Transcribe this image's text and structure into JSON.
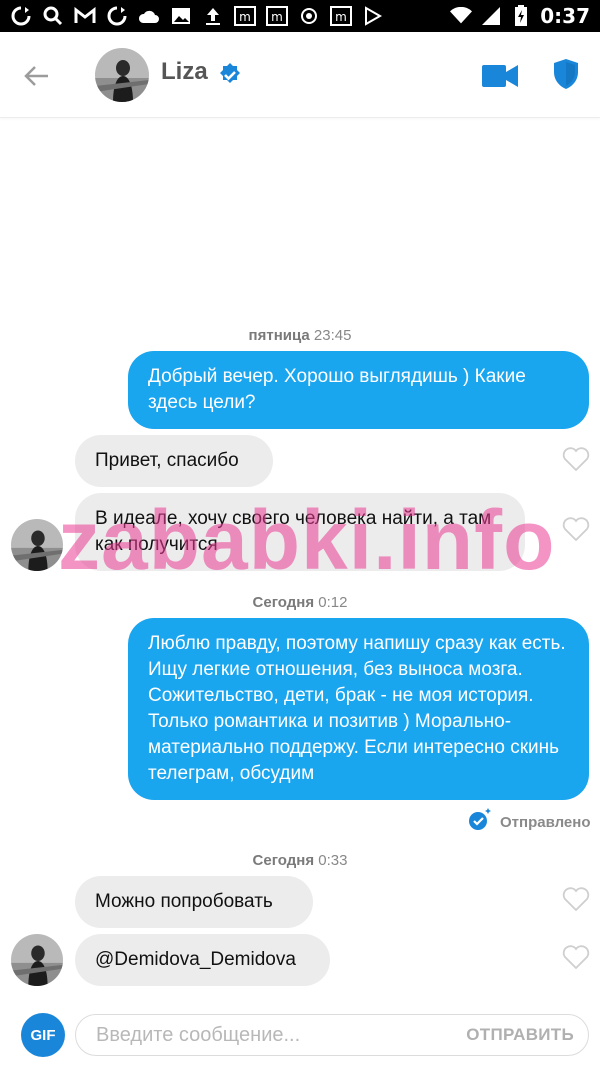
{
  "status_bar": {
    "time": "0:37",
    "icons": [
      "sync-icon",
      "search-icon",
      "gmail-icon",
      "sync-icon",
      "cloud-icon",
      "image-icon",
      "upload-icon",
      "m-icon",
      "m-icon",
      "android-icon",
      "m-icon",
      "play-icon",
      "wifi-icon",
      "signal-icon",
      "battery-icon"
    ]
  },
  "header": {
    "name": "Liza",
    "verified": true
  },
  "messages": [
    {
      "type": "timestamp",
      "day": "пятница",
      "time": "23:45"
    },
    {
      "type": "outgoing",
      "text": "Добрый вечер. Хорошо выглядишь ) Какие здесь цели?"
    },
    {
      "type": "incoming",
      "text": "Привет, спасибо"
    },
    {
      "type": "incoming",
      "text": "В идеале, хочу своего человека найти, а там как получится"
    },
    {
      "type": "timestamp",
      "day": "Сегодня",
      "time": "0:12"
    },
    {
      "type": "outgoing",
      "text": "Люблю правду, поэтому напишу сразу как есть. Ищу легкие отношения, без выноса мозга. Сожительство, дети, брак - не моя история. Только романтика и позитив ) Морально-материально поддержу. Если интересно скинь телеграм, обсудим"
    },
    {
      "type": "status",
      "text": "Отправлено"
    },
    {
      "type": "timestamp",
      "day": "Сегодня",
      "time": "0:33"
    },
    {
      "type": "incoming",
      "text": "Можно попробовать"
    },
    {
      "type": "incoming",
      "text": "@Demidova_Demidova"
    }
  ],
  "watermark": "zababki.info",
  "composer": {
    "gif_label": "GIF",
    "placeholder": "Введите сообщение...",
    "send_label": "ОТПРАВИТЬ"
  },
  "colors": {
    "accent": "#1aa5ef",
    "incoming_bubble": "#ececec",
    "verified": "#1a86d9",
    "watermark": "#eb3c96"
  }
}
